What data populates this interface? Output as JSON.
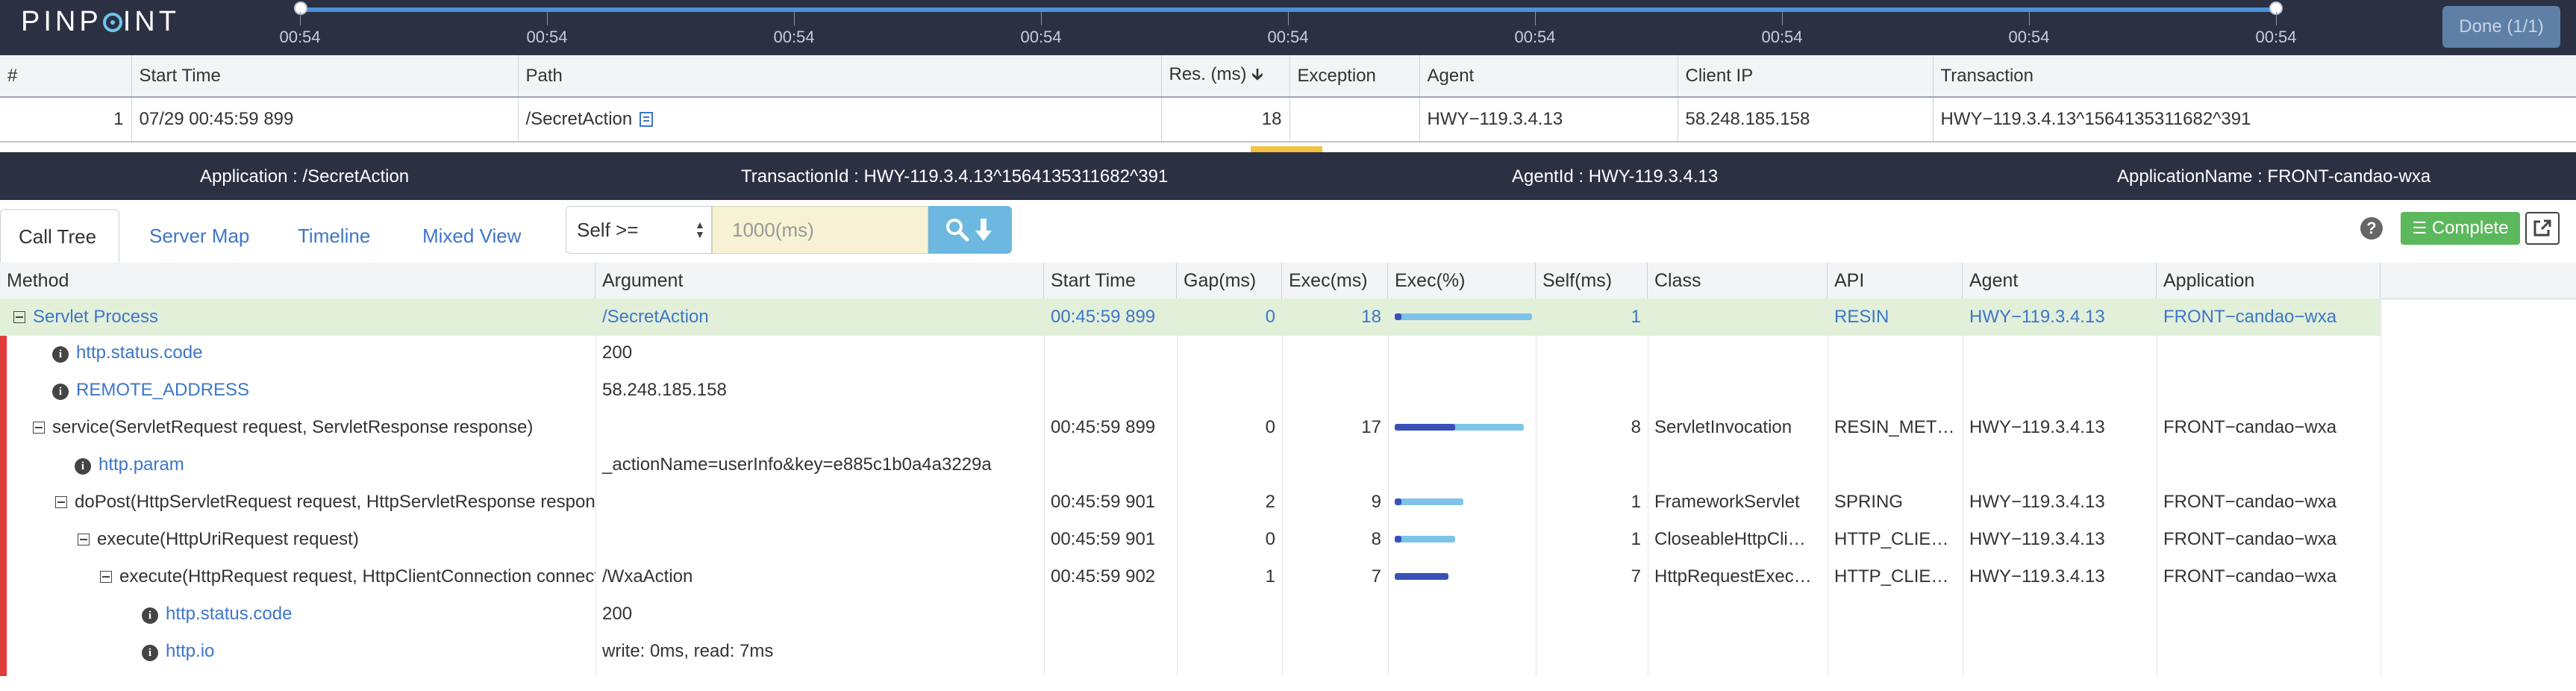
{
  "header": {
    "logo": "PINPOINT",
    "timeline_labels": [
      "00:54",
      "00:54",
      "00:54",
      "00:54",
      "00:54",
      "00:54",
      "00:54",
      "00:54",
      "00:54"
    ],
    "done_button": "Done (1/1)"
  },
  "tx_table": {
    "columns": [
      "#",
      "Start Time",
      "Path",
      "Res. (ms)",
      "Exception",
      "Agent",
      "Client IP",
      "Transaction"
    ],
    "sort_indicator": "arrow-down-icon",
    "rows": [
      {
        "index": "1",
        "start_time": "07/29 00:45:59 899",
        "path": "/SecretAction",
        "res": "18",
        "exception": "",
        "agent": "HWY−119.3.4.13",
        "client_ip": "58.248.185.158",
        "transaction": "HWY−119.3.4.13^1564135311682^391"
      }
    ]
  },
  "info_bar": {
    "application": "Application : /SecretAction",
    "transaction_id": "TransactionId : HWY-119.3.4.13^1564135311682^391",
    "agent_id": "AgentId : HWY-119.3.4.13",
    "application_name": "ApplicationName : FRONT-candao-wxa"
  },
  "tabs": [
    "Call Tree",
    "Server Map",
    "Timeline",
    "Mixed View"
  ],
  "filter": {
    "select_value": "Self >=",
    "input_placeholder": "1000(ms)"
  },
  "complete_button": "Complete",
  "call_tree": {
    "columns": [
      "Method",
      "Argument",
      "Start Time",
      "Gap(ms)",
      "Exec(ms)",
      "Exec(%)",
      "Self(ms)",
      "Class",
      "API",
      "Agent",
      "Application"
    ],
    "rows": [
      {
        "method": "Servlet Process",
        "argument": "/SecretAction",
        "start": "00:45:59 899",
        "gap": "0",
        "exec": "18",
        "exec_pct": 100,
        "self_pct": 5,
        "self": "1",
        "class": "",
        "api": "RESIN",
        "agent": "HWY−119.3.4.13",
        "application": "FRONT−candao−wxa"
      },
      {
        "method": "http.status.code",
        "argument": "200",
        "start": "",
        "gap": "",
        "exec": "",
        "exec_pct": null,
        "self_pct": null,
        "self": "",
        "class": "",
        "api": "",
        "agent": "",
        "application": ""
      },
      {
        "method": "REMOTE_ADDRESS",
        "argument": "58.248.185.158",
        "start": "",
        "gap": "",
        "exec": "",
        "exec_pct": null,
        "self_pct": null,
        "self": "",
        "class": "",
        "api": "",
        "agent": "",
        "application": ""
      },
      {
        "method": "service(ServletRequest request, ServletResponse response)",
        "argument": "",
        "start": "00:45:59 899",
        "gap": "0",
        "exec": "17",
        "exec_pct": 94,
        "self_pct": 44,
        "self": "8",
        "class": "ServletInvocation",
        "api": "RESIN_MET…",
        "agent": "HWY−119.3.4.13",
        "application": "FRONT−candao−wxa"
      },
      {
        "method": "http.param",
        "argument": "_actionName=userInfo&key=e885c1b0a4a3229a",
        "start": "",
        "gap": "",
        "exec": "",
        "exec_pct": null,
        "self_pct": null,
        "self": "",
        "class": "",
        "api": "",
        "agent": "",
        "application": ""
      },
      {
        "method": "doPost(HttpServletRequest request, HttpServletResponse response)",
        "argument": "",
        "start": "00:45:59 901",
        "gap": "2",
        "exec": "9",
        "exec_pct": 50,
        "self_pct": 5,
        "self": "1",
        "class": "FrameworkServlet",
        "api": "SPRING",
        "agent": "HWY−119.3.4.13",
        "application": "FRONT−candao−wxa"
      },
      {
        "method": "execute(HttpUriRequest request)",
        "argument": "",
        "start": "00:45:59 901",
        "gap": "0",
        "exec": "8",
        "exec_pct": 44,
        "self_pct": 5,
        "self": "1",
        "class": "CloseableHttpCli…",
        "api": "HTTP_CLIE…",
        "agent": "HWY−119.3.4.13",
        "application": "FRONT−candao−wxa"
      },
      {
        "method": "execute(HttpRequest request, HttpClientConnection connection)",
        "argument": "/WxaAction",
        "start": "00:45:59 902",
        "gap": "1",
        "exec": "7",
        "exec_pct": 39,
        "self_pct": 39,
        "self": "7",
        "class": "HttpRequestExec…",
        "api": "HTTP_CLIE…",
        "agent": "HWY−119.3.4.13",
        "application": "FRONT−candao−wxa"
      },
      {
        "method": "http.status.code",
        "argument": "200",
        "start": "",
        "gap": "",
        "exec": "",
        "exec_pct": null,
        "self_pct": null,
        "self": "",
        "class": "",
        "api": "",
        "agent": "",
        "application": ""
      },
      {
        "method": "http.io",
        "argument": "write: 0ms, read: 7ms",
        "start": "",
        "gap": "",
        "exec": "",
        "exec_pct": null,
        "self_pct": null,
        "self": "",
        "class": "",
        "api": "",
        "agent": "",
        "application": ""
      }
    ]
  }
}
